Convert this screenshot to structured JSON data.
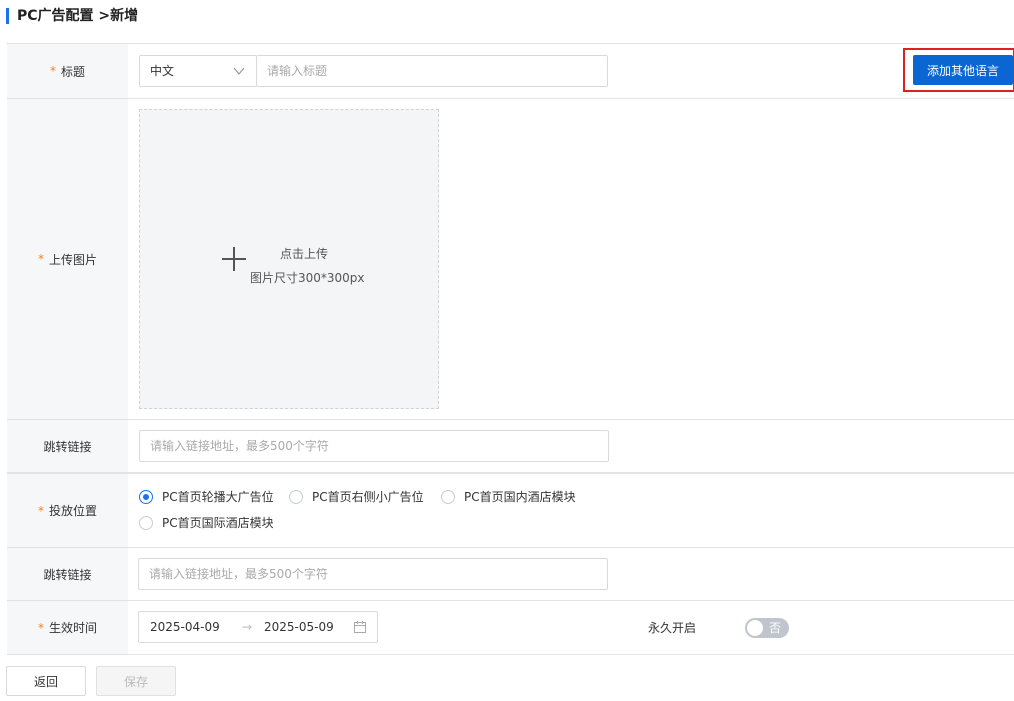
{
  "page": {
    "title": "PC广告配置 >新增"
  },
  "colors": {
    "accent": "#1a73e8",
    "primary_button": "#0a66d2",
    "required_star": "#f5831f",
    "highlight": "#e02020"
  },
  "form": {
    "required_mark": "*",
    "title_row": {
      "label": "标题",
      "language_select": {
        "value": "中文",
        "icon": "chevron-down-icon"
      },
      "title_input": {
        "placeholder": "请输入标题",
        "value": ""
      },
      "add_language_button": "添加其他语言"
    },
    "image_row": {
      "label": "上传图片",
      "upload": {
        "icon": "plus-icon",
        "text": "点击上传",
        "hint": "图片尺寸300*300px"
      }
    },
    "link_row_1": {
      "label": "跳转链接",
      "input": {
        "placeholder": "请输入链接地址，最多500个字符",
        "value": ""
      }
    },
    "position_row": {
      "label": "投放位置",
      "options": [
        {
          "label": "PC首页轮播大广告位",
          "checked": true
        },
        {
          "label": "PC首页右侧小广告位",
          "checked": false
        },
        {
          "label": "PC首页国内酒店模块",
          "checked": false
        },
        {
          "label": "PC首页国际酒店模块",
          "checked": false
        }
      ]
    },
    "link_row_2": {
      "label": "跳转链接",
      "input": {
        "placeholder": "请输入链接地址，最多500个字符",
        "value": ""
      }
    },
    "time_row": {
      "label": "生效时间",
      "start_date": "2025-04-09",
      "separator": "→",
      "end_date": "2025-05-09",
      "calendar_icon": "calendar-icon",
      "permanent_label": "永久开启",
      "permanent_switch": {
        "on": false,
        "text": "否"
      }
    }
  },
  "footer": {
    "back_button": "返回",
    "save_button": "保存"
  }
}
